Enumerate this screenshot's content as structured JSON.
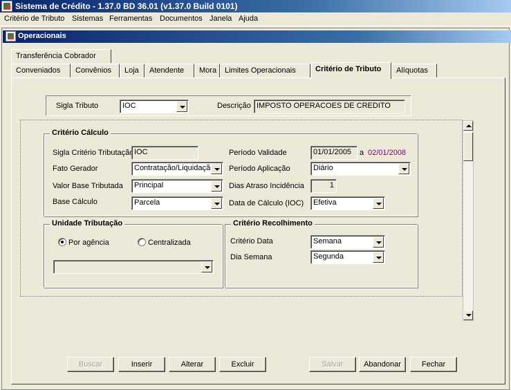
{
  "window": {
    "title": "Sistema de Crédito - 1.37.0 BD 36.01 (v1.37.0 Build 0101)"
  },
  "menu": [
    "Critério de Tributo",
    "Sistemas",
    "Ferramentas",
    "Documentos",
    "Janela",
    "Ajuda"
  ],
  "child_window": {
    "title": "Operacionais"
  },
  "tabs_row1": [
    "Transferência Cobrador"
  ],
  "tabs_row2": [
    "Conveniados",
    "Convênios",
    "Loja",
    "Atendente",
    "Mora",
    "Limites Operacionais",
    "Critério de Tributo",
    "Alíquotas"
  ],
  "active_tab": "Critério de Tributo",
  "header": {
    "sigla_label": "Sigla Tributo",
    "sigla_value": "IOC",
    "descricao_label": "Descrição",
    "descricao_value": "IMPOSTO OPERACOES DE CREDITO"
  },
  "criterio_calculo": {
    "title": "Critério Cálculo",
    "sigla_criterio_label": "Sigla Critério Tributação",
    "sigla_criterio_value": "IOC",
    "fato_gerador_label": "Fato Gerador",
    "fato_gerador_value": "Contratação/Liquidação",
    "valor_base_label": "Valor Base Tributada",
    "valor_base_value": "Principal",
    "base_calculo_label": "Base Cálculo",
    "base_calculo_value": "Parcela",
    "periodo_validade_label": "Período Validade",
    "periodo_inicio": "01/01/2005",
    "periodo_sep": "a",
    "periodo_fim": "02/01/2008",
    "periodo_aplicacao_label": "Período Aplicação",
    "periodo_aplicacao_value": "Diário",
    "dias_atraso_label": "Dias Atraso Incidência",
    "dias_atraso_value": "1",
    "data_calculo_label": "Data de Cálculo (IOC)",
    "data_calculo_value": "Efetiva"
  },
  "unidade_tributacao": {
    "title": "Unidade Tributação",
    "option_agencia": "Por agência",
    "option_centralizada": "Centralizada",
    "selected": "Por agência",
    "combo_value": ""
  },
  "criterio_recolhimento": {
    "title": "Critério Recolhimento",
    "criterio_data_label": "Critério Data",
    "criterio_data_value": "Semana",
    "dia_semana_label": "Dia Semana",
    "dia_semana_value": "Segunda"
  },
  "buttons": {
    "buscar": "Buscar",
    "inserir": "Inserir",
    "alterar": "Alterar",
    "excluir": "Excluir",
    "salvar": "Salvar",
    "abandonar": "Abandonar",
    "fechar": "Fechar"
  },
  "colors": {
    "titlebar": "#0a246a",
    "window_bg": "#ece9d8",
    "date_end": "#800080"
  }
}
